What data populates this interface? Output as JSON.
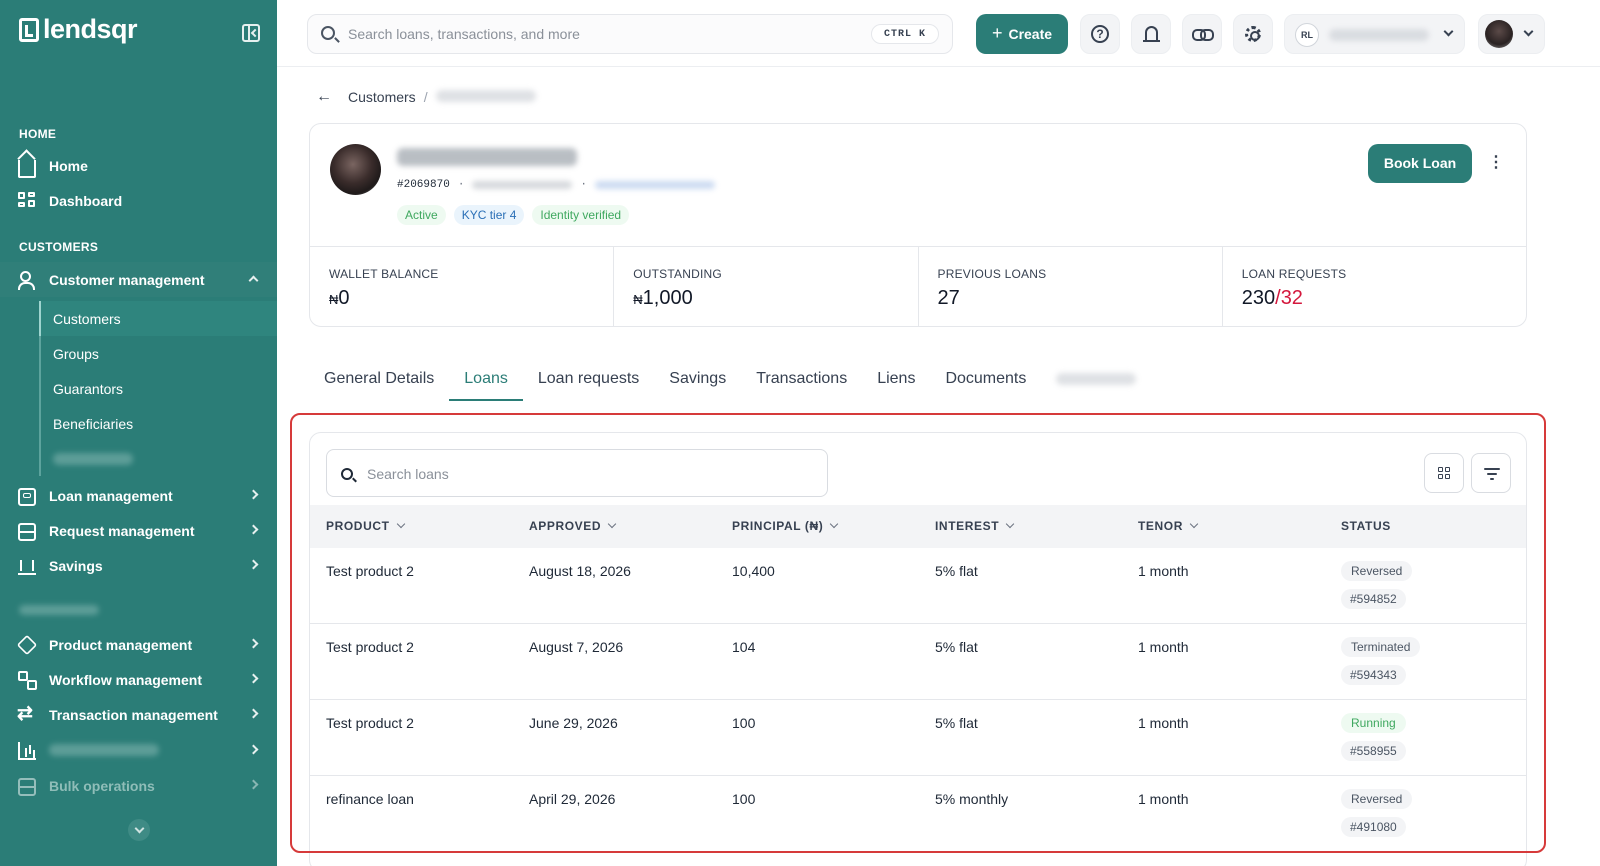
{
  "brand": {
    "name": "lendsqr"
  },
  "sidebar": {
    "sections": {
      "home": "HOME",
      "customers": "CUSTOMERS"
    },
    "home_items": [
      {
        "label": "Home",
        "icon": "home-icon"
      },
      {
        "label": "Dashboard",
        "icon": "dashboard-icon"
      }
    ],
    "customer_management": {
      "label": "Customer management",
      "icon": "users-icon"
    },
    "customer_sub_items": [
      "Customers",
      "Groups",
      "Guarantors",
      "Beneficiaries"
    ],
    "items": [
      {
        "label": "Loan management",
        "icon": "card-icon"
      },
      {
        "label": "Request management",
        "icon": "inbox-icon"
      },
      {
        "label": "Savings",
        "icon": "bank-icon"
      },
      {
        "label": "Product management",
        "icon": "box-icon"
      },
      {
        "label": "Workflow management",
        "icon": "workflow-icon"
      },
      {
        "label": "Transaction management",
        "icon": "swap-icon"
      }
    ],
    "bulk_operations": {
      "label": "Bulk operations",
      "icon": "inbox-icon"
    }
  },
  "topbar": {
    "search_placeholder": "Search loans, transactions, and more",
    "shortcut": "CTRL K",
    "create_label": "Create",
    "org_initials": "RL",
    "icons": [
      "help-icon",
      "bell-icon",
      "link-icon",
      "gear-icon"
    ]
  },
  "breadcrumb": {
    "parent": "Customers",
    "separator": "/"
  },
  "customer": {
    "id": "#2069870",
    "tags": [
      "Active",
      "KYC tier 4",
      "Identity verified"
    ],
    "book_loan_label": "Book Loan",
    "stats": [
      {
        "label": "WALLET BALANCE",
        "currency": "₦",
        "value": "0"
      },
      {
        "label": "OUTSTANDING",
        "currency": "₦",
        "value": "1,000"
      },
      {
        "label": "PREVIOUS LOANS",
        "value": "27"
      },
      {
        "label": "LOAN REQUESTS",
        "value": "230",
        "separator": "/",
        "secondary": "32"
      }
    ]
  },
  "tabs": [
    "General Details",
    "Loans",
    "Loan requests",
    "Savings",
    "Transactions",
    "Liens",
    "Documents"
  ],
  "active_tab": "Loans",
  "loans": {
    "search_placeholder": "Search loans",
    "columns": [
      "PRODUCT",
      "APPROVED",
      "PRINCIPAL (₦)",
      "INTEREST",
      "TENOR",
      "STATUS"
    ],
    "rows": [
      {
        "product": "Test product 2",
        "approved": "August 18, 2026",
        "principal": "10,400",
        "interest": "5% flat",
        "tenor": "1 month",
        "status": "Reversed",
        "ref": "#594852"
      },
      {
        "product": "Test product 2",
        "approved": "August 7, 2026",
        "principal": "104",
        "interest": "5% flat",
        "tenor": "1 month",
        "status": "Terminated",
        "ref": "#594343"
      },
      {
        "product": "Test product 2",
        "approved": "June 29, 2026",
        "principal": "100",
        "interest": "5% flat",
        "tenor": "1 month",
        "status": "Running",
        "ref": "#558955"
      },
      {
        "product": "refinance loan",
        "approved": "April 29, 2026",
        "principal": "100",
        "interest": "5% monthly",
        "tenor": "1 month",
        "status": "Reversed",
        "ref": "#491080"
      }
    ]
  },
  "colors": {
    "brand": "#2b7d77",
    "highlight": "#d63a3a",
    "running": "#3fa85f",
    "accent_red": "#d4183d"
  }
}
